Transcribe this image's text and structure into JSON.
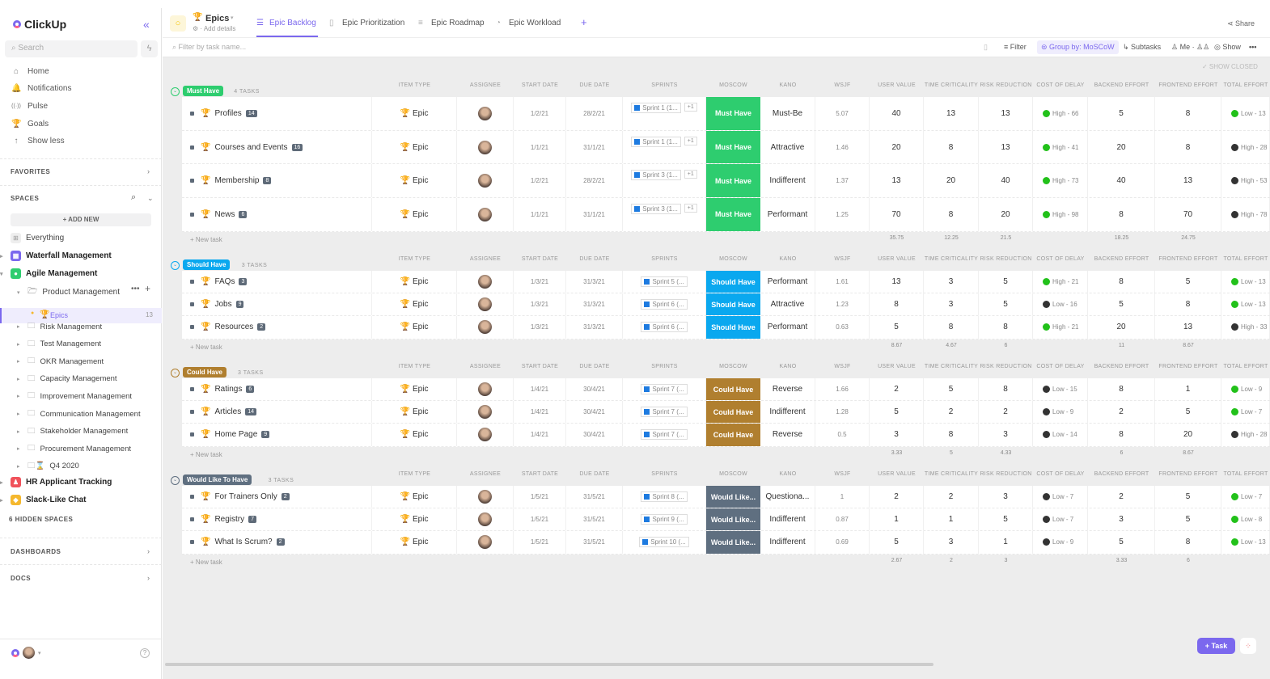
{
  "app": {
    "logo": "ClickUp"
  },
  "sidebar": {
    "search_placeholder": "Search",
    "nav": [
      {
        "label": "Home",
        "icon": "home-icon",
        "glyph": "⌂"
      },
      {
        "label": "Notifications",
        "icon": "bell-icon",
        "glyph": "🔔"
      },
      {
        "label": "Pulse",
        "icon": "pulse-icon",
        "glyph": "((·))"
      },
      {
        "label": "Goals",
        "icon": "trophy-icon",
        "glyph": "🏆"
      },
      {
        "label": "Show less",
        "icon": "arrow-up-icon",
        "glyph": "↑"
      }
    ],
    "favorites": "FAVORITES",
    "spaces": "SPACES",
    "add_new": "+ ADD NEW",
    "everything": "Everything",
    "spaces_list": [
      {
        "label": "Waterfall Management",
        "color": "#7b68ee"
      },
      {
        "label": "Agile Management",
        "color": "#2ecd6f"
      }
    ],
    "folder": "Product Management",
    "epics": {
      "label": "Epics",
      "count": "13"
    },
    "folders": [
      "Risk Management",
      "Test Management",
      "OKR Management",
      "Capacity Management",
      "Improvement Management",
      "Communication Management",
      "Stakeholder Management",
      "Procurement Management",
      "Q4 2020"
    ],
    "other_spaces": [
      {
        "label": "HR Applicant Tracking",
        "color": "#f0525b"
      },
      {
        "label": "Slack-Like Chat",
        "color": "#f5b82e"
      }
    ],
    "hidden": "6 HIDDEN SPACES",
    "dashboards": "DASHBOARDS",
    "docs": "DOCS"
  },
  "header": {
    "list_title": "Epics",
    "add_details": "Add details",
    "tabs": [
      "Epic Backlog",
      "Epic Prioritization",
      "Epic Roadmap",
      "Epic Workload"
    ],
    "active_tab": 0,
    "share": "Share",
    "filter_placeholder": "Filter by task name...",
    "filter": "Filter",
    "group_by": "Group by: MoSCoW",
    "subtasks": "Subtasks",
    "me": "Me",
    "show": "Show",
    "show_closed": "✓ SHOW CLOSED"
  },
  "columns": [
    "ITEM TYPE",
    "ASSIGNEE",
    "START DATE",
    "DUE DATE",
    "SPRINTS",
    "MOSCOW",
    "KANO",
    "WSJF",
    "USER VALUE",
    "TIME CRITICALITY",
    "RISK REDUCTION",
    "COST OF DELAY",
    "BACKEND EFFORT",
    "FRONTEND EFFORT",
    "TOTAL EFFORT"
  ],
  "new_task": "+ New task",
  "groups": [
    {
      "name": "Must Have",
      "color": "#2ecd6f",
      "count": "4 TASKS",
      "totals": {
        "uv": "35.75",
        "tc": "12.25",
        "rr": "21.5",
        "be": "18.25",
        "fe": "24.75"
      },
      "tasks": [
        {
          "name": "Profiles",
          "sub": "14",
          "type": "Epic",
          "start": "1/2/21",
          "due": "28/2/21",
          "sprint": "Sprint 1 (1...",
          "extra": "+1",
          "moscow": "Must Have",
          "kano": "Must-Be",
          "wsjf": "5.07",
          "uv": "40",
          "tc": "13",
          "rr": "13",
          "cod": "High - 66",
          "cod_c": "#22c11a",
          "be": "5",
          "fe": "8",
          "te": "Low - 13",
          "te_c": "#22c11a"
        },
        {
          "name": "Courses and Events",
          "sub": "16",
          "type": "Epic",
          "start": "1/1/21",
          "due": "31/1/21",
          "sprint": "Sprint 1 (1...",
          "extra": "+1",
          "moscow": "Must Have",
          "kano": "Attractive",
          "wsjf": "1.46",
          "uv": "20",
          "tc": "8",
          "rr": "13",
          "cod": "High - 41",
          "cod_c": "#22c11a",
          "be": "20",
          "fe": "8",
          "te": "High - 28",
          "te_c": "#333"
        },
        {
          "name": "Membership",
          "sub": "8",
          "type": "Epic",
          "start": "1/2/21",
          "due": "28/2/21",
          "sprint": "Sprint 3 (1...",
          "extra": "+1",
          "moscow": "Must Have",
          "kano": "Indifferent",
          "wsjf": "1.37",
          "uv": "13",
          "tc": "20",
          "rr": "40",
          "cod": "High - 73",
          "cod_c": "#22c11a",
          "be": "40",
          "fe": "13",
          "te": "High - 53",
          "te_c": "#333"
        },
        {
          "name": "News",
          "sub": "6",
          "type": "Epic",
          "start": "1/1/21",
          "due": "31/1/21",
          "sprint": "Sprint 3 (1...",
          "extra": "+1",
          "moscow": "Must Have",
          "kano": "Performant",
          "wsjf": "1.25",
          "uv": "70",
          "tc": "8",
          "rr": "20",
          "cod": "High - 98",
          "cod_c": "#22c11a",
          "be": "8",
          "fe": "70",
          "te": "High - 78",
          "te_c": "#333"
        }
      ]
    },
    {
      "name": "Should Have",
      "color": "#0aa8ef",
      "count": "3 TASKS",
      "totals": {
        "uv": "8.67",
        "tc": "4.67",
        "rr": "6",
        "be": "11",
        "fe": "8.67"
      },
      "tasks": [
        {
          "name": "FAQs",
          "sub": "3",
          "type": "Epic",
          "start": "1/3/21",
          "due": "31/3/21",
          "sprint": "Sprint 5 (...",
          "moscow": "Should Have",
          "kano": "Performant",
          "wsjf": "1.61",
          "uv": "13",
          "tc": "3",
          "rr": "5",
          "cod": "High - 21",
          "cod_c": "#22c11a",
          "be": "8",
          "fe": "5",
          "te": "Low - 13",
          "te_c": "#22c11a"
        },
        {
          "name": "Jobs",
          "sub": "9",
          "type": "Epic",
          "start": "1/3/21",
          "due": "31/3/21",
          "sprint": "Sprint 6 (...",
          "moscow": "Should Have",
          "kano": "Attractive",
          "wsjf": "1.23",
          "uv": "8",
          "tc": "3",
          "rr": "5",
          "cod": "Low - 16",
          "cod_c": "#333",
          "be": "5",
          "fe": "8",
          "te": "Low - 13",
          "te_c": "#22c11a"
        },
        {
          "name": "Resources",
          "sub": "2",
          "type": "Epic",
          "start": "1/3/21",
          "due": "31/3/21",
          "sprint": "Sprint 6 (...",
          "moscow": "Should Have",
          "kano": "Performant",
          "wsjf": "0.63",
          "uv": "5",
          "tc": "8",
          "rr": "8",
          "cod": "High - 21",
          "cod_c": "#22c11a",
          "be": "20",
          "fe": "13",
          "te": "High - 33",
          "te_c": "#333"
        }
      ]
    },
    {
      "name": "Could Have",
      "color": "#b07f2f",
      "count": "3 TASKS",
      "totals": {
        "uv": "3.33",
        "tc": "5",
        "rr": "4.33",
        "be": "6",
        "fe": "8.67"
      },
      "tasks": [
        {
          "name": "Ratings",
          "sub": "6",
          "type": "Epic",
          "start": "1/4/21",
          "due": "30/4/21",
          "sprint": "Sprint 7 (...",
          "moscow": "Could Have",
          "kano": "Reverse",
          "wsjf": "1.66",
          "uv": "2",
          "tc": "5",
          "rr": "8",
          "cod": "Low - 15",
          "cod_c": "#333",
          "be": "8",
          "fe": "1",
          "te": "Low - 9",
          "te_c": "#22c11a"
        },
        {
          "name": "Articles",
          "sub": "14",
          "type": "Epic",
          "start": "1/4/21",
          "due": "30/4/21",
          "sprint": "Sprint 7 (...",
          "moscow": "Could Have",
          "kano": "Indifferent",
          "wsjf": "1.28",
          "uv": "5",
          "tc": "2",
          "rr": "2",
          "cod": "Low - 9",
          "cod_c": "#333",
          "be": "2",
          "fe": "5",
          "te": "Low - 7",
          "te_c": "#22c11a"
        },
        {
          "name": "Home Page",
          "sub": "9",
          "type": "Epic",
          "start": "1/4/21",
          "due": "30/4/21",
          "sprint": "Sprint 7 (...",
          "moscow": "Could Have",
          "kano": "Reverse",
          "wsjf": "0.5",
          "uv": "3",
          "tc": "8",
          "rr": "3",
          "cod": "Low - 14",
          "cod_c": "#333",
          "be": "8",
          "fe": "20",
          "te": "High - 28",
          "te_c": "#333"
        }
      ]
    },
    {
      "name": "Would Like To Have",
      "color": "#5f6f80",
      "count": "3 TASKS",
      "totals": {
        "uv": "2.67",
        "tc": "2",
        "rr": "3",
        "be": "3.33",
        "fe": "6"
      },
      "tasks": [
        {
          "name": "For Trainers Only",
          "sub": "2",
          "type": "Epic",
          "start": "1/5/21",
          "due": "31/5/21",
          "sprint": "Sprint 8 (...",
          "moscow": "Would Like...",
          "kano": "Questiona...",
          "wsjf": "1",
          "uv": "2",
          "tc": "2",
          "rr": "3",
          "cod": "Low - 7",
          "cod_c": "#333",
          "be": "2",
          "fe": "5",
          "te": "Low - 7",
          "te_c": "#22c11a"
        },
        {
          "name": "Registry",
          "sub": "7",
          "type": "Epic",
          "start": "1/5/21",
          "due": "31/5/21",
          "sprint": "Sprint 9 (...",
          "moscow": "Would Like...",
          "kano": "Indifferent",
          "wsjf": "0.87",
          "uv": "1",
          "tc": "1",
          "rr": "5",
          "cod": "Low - 7",
          "cod_c": "#333",
          "be": "3",
          "fe": "5",
          "te": "Low - 8",
          "te_c": "#22c11a"
        },
        {
          "name": "What Is Scrum?",
          "sub": "2",
          "type": "Epic",
          "start": "1/5/21",
          "due": "31/5/21",
          "sprint": "Sprint 10 (...",
          "moscow": "Would Like...",
          "kano": "Indifferent",
          "wsjf": "0.69",
          "uv": "5",
          "tc": "3",
          "rr": "1",
          "cod": "Low - 9",
          "cod_c": "#333",
          "be": "5",
          "fe": "8",
          "te": "Low - 13",
          "te_c": "#22c11a"
        }
      ]
    }
  ],
  "task_button": "+ Task"
}
